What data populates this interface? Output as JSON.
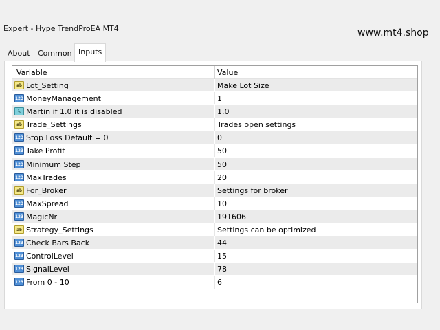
{
  "window": {
    "title": "Expert - Hype TrendProEA MT4",
    "watermark": "www.mt4.shop"
  },
  "tabs": [
    {
      "label": "About",
      "active": false
    },
    {
      "label": "Common",
      "active": false
    },
    {
      "label": "Inputs",
      "active": true
    }
  ],
  "grid": {
    "headers": {
      "variable": "Variable",
      "value": "Value"
    },
    "rows": [
      {
        "icon": "ab",
        "icon_text": "ab",
        "name": "Lot_Setting",
        "value": "Make Lot Size"
      },
      {
        "icon": "num",
        "icon_text": "123",
        "name": "MoneyManagement",
        "value": "1"
      },
      {
        "icon": "dbl",
        "icon_text": "½",
        "name": "Martin if 1.0 it is disabled",
        "value": "1.0"
      },
      {
        "icon": "ab",
        "icon_text": "ab",
        "name": "Trade_Settings",
        "value": "Trades open settings"
      },
      {
        "icon": "num",
        "icon_text": "123",
        "name": "Stop Loss Default = 0",
        "value": "0"
      },
      {
        "icon": "num",
        "icon_text": "123",
        "name": "Take Profit",
        "value": "50"
      },
      {
        "icon": "num",
        "icon_text": "123",
        "name": "Minimum Step",
        "value": "50"
      },
      {
        "icon": "num",
        "icon_text": "123",
        "name": "MaxTrades",
        "value": "20"
      },
      {
        "icon": "ab",
        "icon_text": "ab",
        "name": "For_Broker",
        "value": "Settings for broker"
      },
      {
        "icon": "num",
        "icon_text": "123",
        "name": "MaxSpread",
        "value": "10"
      },
      {
        "icon": "num",
        "icon_text": "123",
        "name": "MagicNr",
        "value": "191606"
      },
      {
        "icon": "ab",
        "icon_text": "ab",
        "name": "Strategy_Settings",
        "value": "Settings can be optimized"
      },
      {
        "icon": "num",
        "icon_text": "123",
        "name": "Check Bars Back",
        "value": "44"
      },
      {
        "icon": "num",
        "icon_text": "123",
        "name": "ControlLevel",
        "value": "15"
      },
      {
        "icon": "num",
        "icon_text": "123",
        "name": "SignalLevel",
        "value": "78"
      },
      {
        "icon": "num",
        "icon_text": "123",
        "name": "From 0 - 10",
        "value": "6"
      }
    ]
  }
}
